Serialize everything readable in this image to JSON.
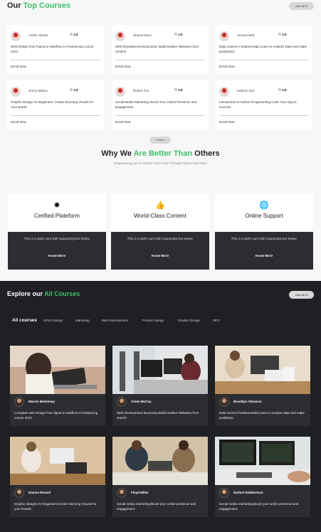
{
  "top_courses": {
    "title_prefix": "Our ",
    "title_highlight": "Top Courses",
    "view_all": "view all ➜",
    "cards": [
      {
        "name": "Arlelin Shaws",
        "rating": "♡ 4.8",
        "desc": "Web Design from Figma to Webflow to Freelancing course 2023",
        "enroll": "Enroll Now"
      },
      {
        "name": "Dianne Russ",
        "rating": "♡ 4.8",
        "desc": "Web Development Bootcamp: Build Modern Websites form Scratch",
        "enroll": "Enroll Now"
      },
      {
        "name": "Jerome Bell",
        "rating": "♡ 4.8",
        "desc": "Data Science Fundamentals Learn to Analyze Data and make predictions",
        "enroll": "Enroll Now"
      },
      {
        "name": "Jenny Wilson",
        "rating": "♡ 4.8",
        "desc": "Graphic Design for Beginners: Create Stunning Visuals for Your Brand",
        "enroll": "Enroll Now"
      },
      {
        "name": "Robert Fox",
        "rating": "♡ 4.8",
        "desc": "Social Media Marketing: Boost Your Online Presence and Engagement",
        "enroll": "Enroll Now"
      },
      {
        "name": "Kathryn mur",
        "rating": "♡ 4.8",
        "desc": "Introduction to Python Programming Code Your way to success",
        "enroll": "Enroll Now"
      }
    ]
  },
  "feature_pill": "Feature",
  "why": {
    "prefix": "Why We ",
    "highlight": "Are Better Than",
    "suffix": " Others",
    "subtitle": "Empowering you To Reach Your Goals Through Online Education"
  },
  "features": [
    {
      "icon": "gear-icon",
      "glyph": "✸",
      "label": "Cerified Plateform",
      "text": "This is a wider card with supporting text below.",
      "button": "Know More"
    },
    {
      "icon": "thumbs-up-icon",
      "glyph": "👍",
      "label": "World-Class Content",
      "text": "This is a wider card with supporting text below.",
      "button": "Know More"
    },
    {
      "icon": "globe-icon",
      "glyph": "🌐",
      "label": "Online Support",
      "text": "This is a wider card with supporting text below.",
      "button": "Know More"
    }
  ],
  "explore": {
    "title_prefix": "Explore our ",
    "title_highlight": "All Courses",
    "view_all": "view all ➜",
    "tabs": [
      "All courses",
      "UI/UX Design",
      "Marketing",
      "Web Development",
      "Product Design",
      "Graphic Design",
      "SEO"
    ],
    "courses": [
      {
        "name": "Marvin McKinney",
        "desc": "Complete web Design from figma to webflow to freelancing course 2023"
      },
      {
        "name": "Arleei McCoy",
        "desc": "Web development Bootcamp:Build modern Websites from search."
      },
      {
        "name": "Brooklyn Simsons",
        "desc": "Data science fundamentals:Learn to analyse data and make prediction."
      },
      {
        "name": "Dianne Russel",
        "desc": "Graphic designe for beginners:Create stunning Visuals for your brands."
      },
      {
        "name": "Floyd Miles",
        "desc": "Social media marketing:Boost your online presence and engagement."
      },
      {
        "name": "Darleni Robbertson",
        "desc": "Social media marketing:Boost your online presence and engagement."
      }
    ]
  },
  "colors": {
    "accent": "#3fbf6a",
    "dark_bg": "#1e2024",
    "card_dark": "#2b2d31"
  }
}
